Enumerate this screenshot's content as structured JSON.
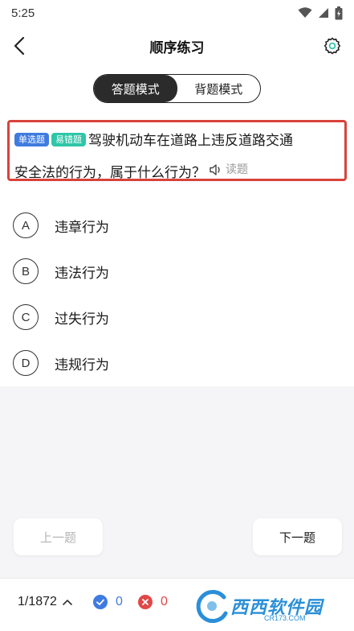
{
  "status_bar": {
    "time": "5:25"
  },
  "header": {
    "title": "顺序练习"
  },
  "mode_toggle": {
    "answer_mode": "答题模式",
    "memorize_mode": "背题模式"
  },
  "question": {
    "tag_type": "单选题",
    "tag_difficulty": "易错题",
    "line1": "驾驶机动车在道路上违反道路交通",
    "line2": "安全法的行为，属于什么行为？",
    "read_label": "读题"
  },
  "options": [
    {
      "letter": "A",
      "text": "违章行为"
    },
    {
      "letter": "B",
      "text": "违法行为"
    },
    {
      "letter": "C",
      "text": "过失行为"
    },
    {
      "letter": "D",
      "text": "违规行为"
    }
  ],
  "navigation": {
    "prev_label": "上一题",
    "next_label": "下一题"
  },
  "footer": {
    "progress": "1/1872",
    "correct_count": "0",
    "wrong_count": "0"
  },
  "watermark": {
    "text": "西西软件园",
    "sub": "CR173.COM"
  },
  "colors": {
    "accent_blue": "#3f7be0",
    "accent_green": "#2fc6a8",
    "error_red": "#e04848",
    "highlight_border": "#d8433b"
  },
  "icons": [
    "wifi-icon",
    "signal-icon",
    "battery-icon",
    "back-icon",
    "settings-icon",
    "speaker-icon",
    "chevron-up-icon",
    "check-circle-icon",
    "cross-circle-icon"
  ]
}
